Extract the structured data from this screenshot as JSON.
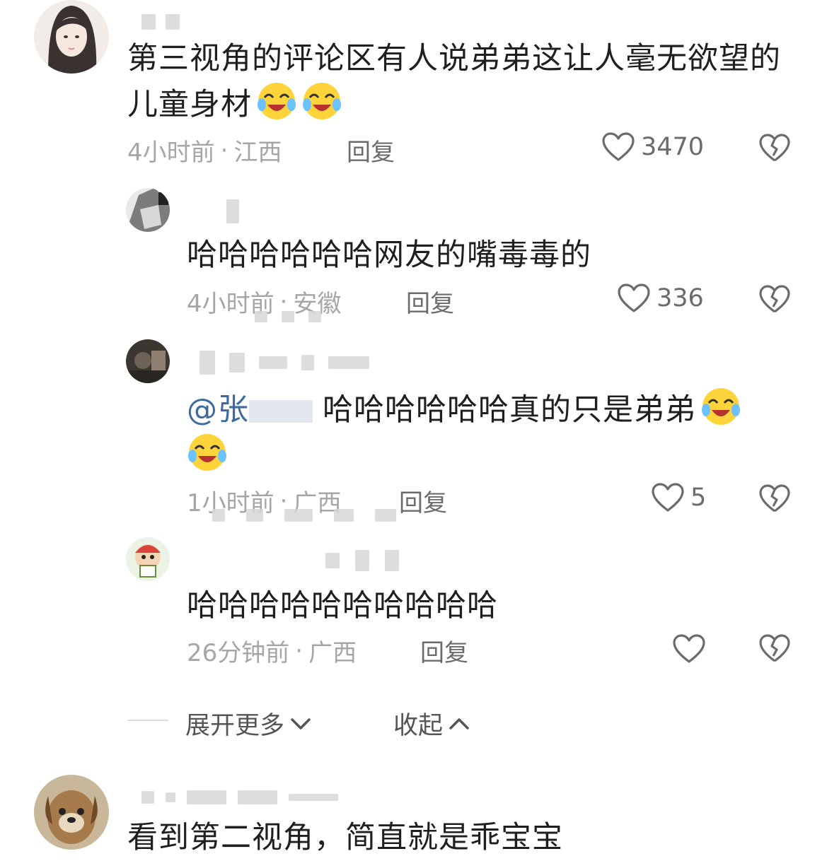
{
  "comments": [
    {
      "text": "第三视角的评论区有人说弟弟这让人毫无欲望的儿童身材",
      "time": "4小时前",
      "location": "江西",
      "reply_label": "回复",
      "likes": "3470"
    },
    {
      "text": "哈哈哈哈哈哈网友的嘴毒毒的",
      "time": "4小时前",
      "location": "安徽",
      "reply_label": "回复",
      "likes": "336"
    },
    {
      "mention": "@张",
      "text": "哈哈哈哈哈哈真的只是弟弟",
      "time": "1小时前",
      "location": "广西",
      "reply_label": "回复",
      "likes": "5"
    },
    {
      "text": "哈哈哈哈哈哈哈哈哈哈",
      "time": "26分钟前",
      "location": "广西",
      "reply_label": "回复",
      "likes": ""
    },
    {
      "text": "看到第二视角，简直就是乖宝宝"
    }
  ],
  "thread": {
    "expand_label": "展开更多",
    "collapse_label": "收起"
  },
  "separator": "·",
  "icons": {
    "like": "heart-outline-icon",
    "dislike": "broken-heart-icon",
    "emoji": "crying-laughing-emoji",
    "expand": "chevron-down-icon",
    "collapse": "chevron-up-icon"
  },
  "colors": {
    "mention": "#3d6aa0",
    "meta": "#a6a6a6"
  }
}
